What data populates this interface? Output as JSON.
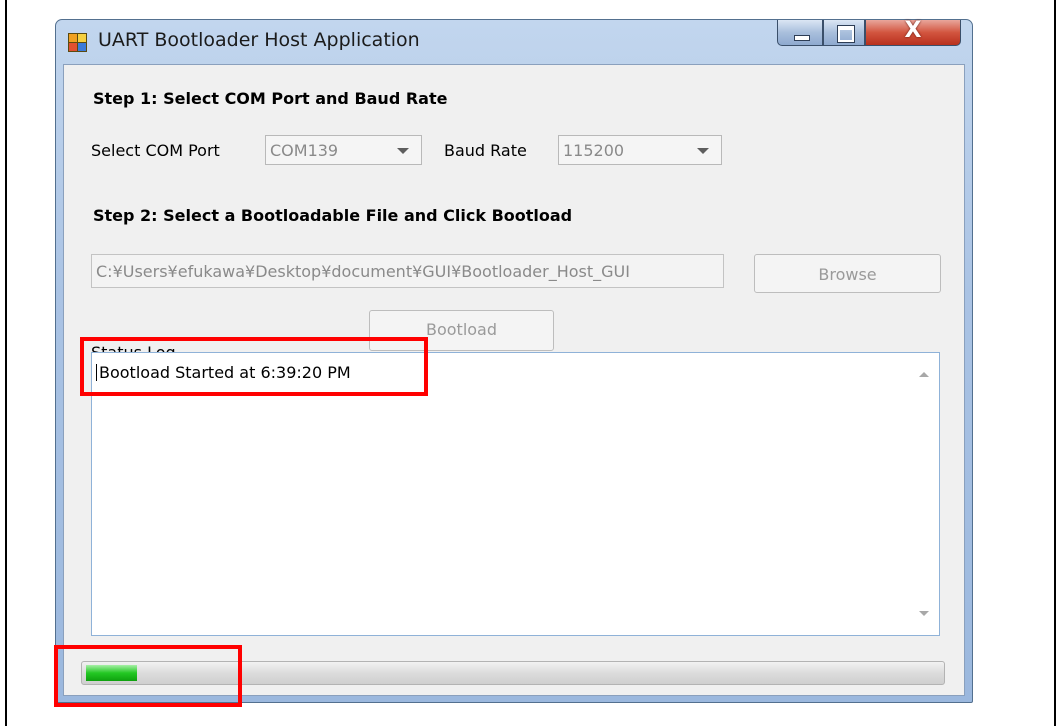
{
  "window": {
    "title": "UART Bootloader Host Application",
    "close_glyph": "X"
  },
  "step1": {
    "heading": "Step 1: Select COM Port and Baud Rate",
    "com_port_label": "Select COM Port",
    "com_port_value": "COM139",
    "baud_rate_label": "Baud Rate",
    "baud_rate_value": "115200"
  },
  "step2": {
    "heading": "Step 2: Select a Bootloadable File and Click Bootload",
    "file_path": "C:¥Users¥efukawa¥Desktop¥document¥GUI¥Bootloader_Host_GUI",
    "browse_label": "Browse",
    "bootload_label": "Bootload"
  },
  "status_log": {
    "label": "Status Log",
    "text": "Bootload Started at 6:39:20 PM"
  },
  "progress": {
    "percent": 6,
    "fill_color": "#1ec81e"
  },
  "annotations": {
    "highlight_color": "#ff0000"
  }
}
